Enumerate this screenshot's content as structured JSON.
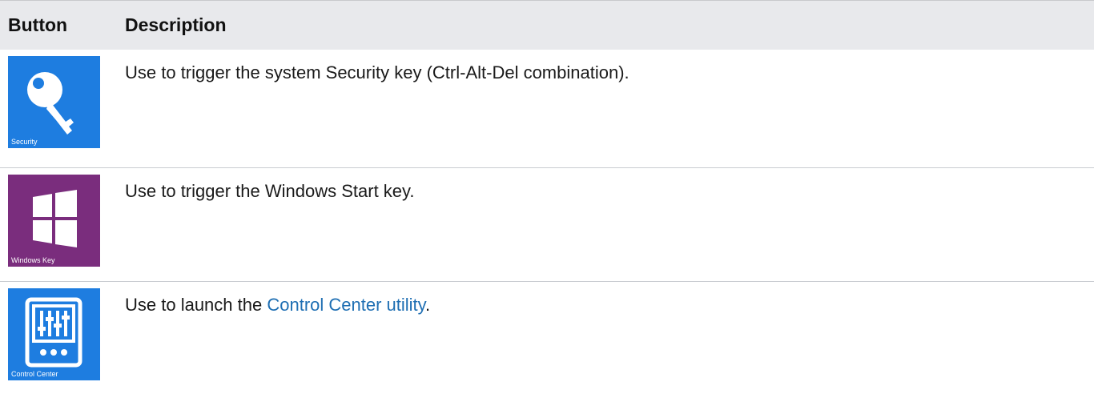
{
  "table": {
    "headers": {
      "button": "Button",
      "description": "Description"
    },
    "rows": [
      {
        "tile_label": "Security",
        "tile_color": "#1e7de0",
        "icon": "key-icon",
        "description": "Use to trigger the system Security key (Ctrl-Alt-Del combination)."
      },
      {
        "tile_label": "Windows Key",
        "tile_color": "#7a2d7d",
        "icon": "windows-logo-icon",
        "description": "Use to trigger the Windows Start key."
      },
      {
        "tile_label": "Control Center",
        "tile_color": "#1e7de0",
        "icon": "sliders-icon",
        "description_prefix": "Use to launch the ",
        "description_link": "Control Center utility",
        "description_suffix": "."
      }
    ]
  },
  "colors": {
    "link": "#1f6fb3",
    "header_bg": "#e8e9ec"
  }
}
